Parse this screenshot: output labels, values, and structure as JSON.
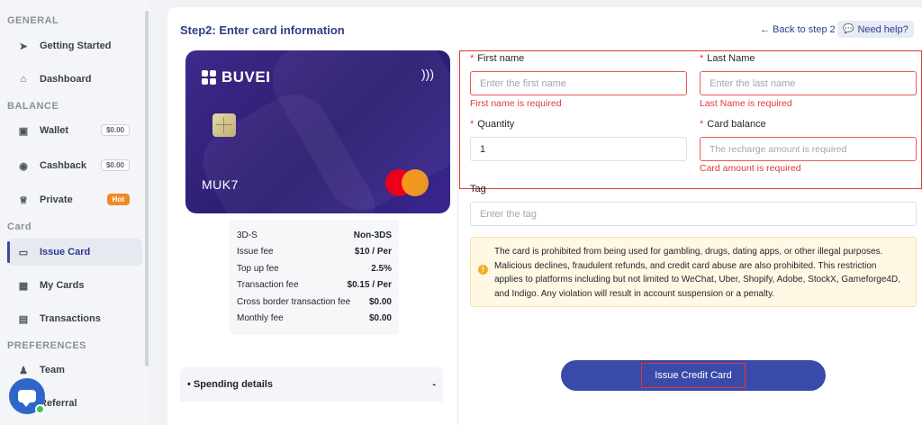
{
  "sidebar": {
    "sections": {
      "general": "GENERAL",
      "balance": "BALANCE",
      "card": "Card",
      "preferences": "PREFERENCES"
    },
    "items": {
      "getting_started": "Getting Started",
      "dashboard": "Dashboard",
      "wallet": "Wallet",
      "wallet_balance": "$0.00",
      "cashback": "Cashback",
      "cashback_balance": "$0.00",
      "private": "Private",
      "private_badge": "Hot",
      "issue_card": "Issue Card",
      "my_cards": "My Cards",
      "transactions": "Transactions",
      "team": "Team",
      "referral": "Referral"
    },
    "icons": {
      "getting_started": "signpost-icon",
      "dashboard": "home-icon",
      "wallet": "wallet-icon",
      "cashback": "camera-icon",
      "private": "crown-icon",
      "issue_card": "card-icon",
      "my_cards": "grid-icon",
      "transactions": "document-icon",
      "team": "team-icon",
      "chat": "chat-icon"
    }
  },
  "header": {
    "title": "Step2: Enter card information",
    "back_link": "← Back to step 2",
    "help": "Need help?"
  },
  "card_preview": {
    "brand": "BUVEI",
    "name": "MUK7",
    "network_icon": "mastercard-icon"
  },
  "fees": [
    {
      "label": "3D-S",
      "value": "Non-3DS"
    },
    {
      "label": "Issue fee",
      "value": "$10 / Per"
    },
    {
      "label": "Top up fee",
      "value": "2.5%"
    },
    {
      "label": "Transaction fee",
      "value": "$0.15 / Per"
    },
    {
      "label": "Cross border transaction fee",
      "value": "$0.00"
    },
    {
      "label": "Monthly fee",
      "value": "$0.00"
    }
  ],
  "spending": {
    "label": "Spending details",
    "toggle": "-"
  },
  "form": {
    "first_name": {
      "label": "First name",
      "placeholder": "Enter the first name",
      "error": "First name is required"
    },
    "last_name": {
      "label": "Last Name",
      "placeholder": "Enter the last name",
      "error": "Last Name is required"
    },
    "quantity": {
      "label": "Quantity",
      "value": "1"
    },
    "card_balance": {
      "label": "Card balance",
      "placeholder": "The recharge amount is required",
      "error": "Card amount is required"
    },
    "tag": {
      "label": "Tag",
      "placeholder": "Enter the tag"
    },
    "required_mark": "*"
  },
  "notice": {
    "text": "The card is prohibited from being used for gambling, drugs, dating apps, or other illegal purposes. Malicious declines, fraudulent refunds, and credit card abuse are also prohibited. This restriction applies to platforms including but not limited to WeChat, Uber, Shopify, Adobe, StockX, Gameforge4D, and Indigo. Any violation will result in account suspension or a penalty."
  },
  "submit": {
    "label": "Issue Credit Card"
  },
  "colors": {
    "accent": "#3a4aa8",
    "error": "#e23838",
    "card": "#2b1b70"
  }
}
